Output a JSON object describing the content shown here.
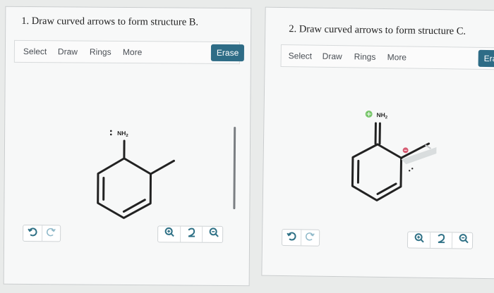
{
  "panels": [
    {
      "question": "1. Draw curved arrows to form structure B.",
      "toolbar": [
        "Select",
        "Draw",
        "Rings",
        "More"
      ],
      "erase": "Erase",
      "molecule_label": "NH2",
      "undo_icon": "undo-icon",
      "redo_icon": "redo-icon",
      "zoom_icons": [
        "zoom-in-icon",
        "reset-zoom-icon",
        "zoom-out-icon"
      ]
    },
    {
      "question": "2. Draw curved arrows to form structure C.",
      "toolbar": [
        "Select",
        "Draw",
        "Rings",
        "More"
      ],
      "erase": "Eras",
      "molecule_label": "NH2",
      "undo_icon": "undo-icon",
      "redo_icon": "redo-icon",
      "zoom_icons": [
        "zoom-in-icon",
        "reset-zoom-icon",
        "zoom-out-icon"
      ]
    }
  ],
  "colors": {
    "accent": "#2e6c86",
    "panel_bg": "#f7f8f8",
    "positive_charge": "#58b947",
    "negative_charge": "#d75b72",
    "arrow": "#c7c9ca"
  }
}
